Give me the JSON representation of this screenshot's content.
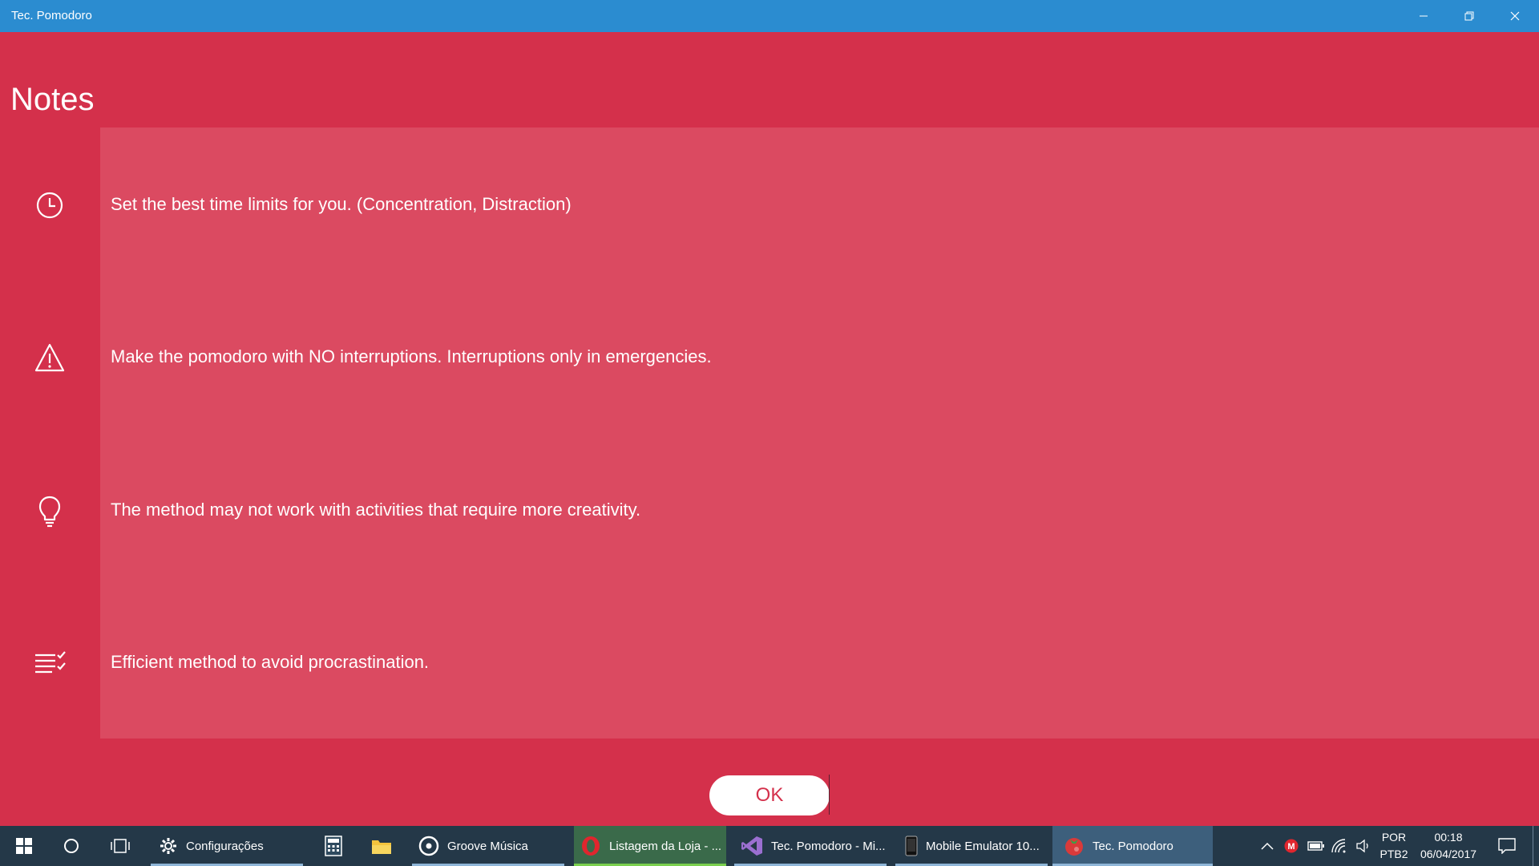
{
  "window": {
    "title": "Tec. Pomodoro",
    "controls": [
      "minimize-icon",
      "restore-icon",
      "close-icon"
    ]
  },
  "page": {
    "title": "Notes"
  },
  "notes": [
    {
      "icon": "clock-icon",
      "text": "Set the best time limits for you. (Concentration, Distraction)"
    },
    {
      "icon": "warning-icon",
      "text": "Make the pomodoro with NO interruptions. Interruptions only in emergencies."
    },
    {
      "icon": "lightbulb-icon",
      "text": "The method may not work with activities that require more creativity."
    },
    {
      "icon": "checklist-icon",
      "text": "Efficient method to avoid procrastination."
    }
  ],
  "ok_button": {
    "label": "OK"
  },
  "taskbar": {
    "items": [
      {
        "icon": "gear-icon",
        "label": "Configurações"
      },
      {
        "icon": "calculator-icon",
        "label": ""
      },
      {
        "icon": "file-explorer-icon",
        "label": ""
      },
      {
        "icon": "groove-music-icon",
        "label": "Groove Música"
      },
      {
        "icon": "opera-icon",
        "label": "Listagem da Loja - ..."
      },
      {
        "icon": "visual-studio-icon",
        "label": "Tec. Pomodoro - Mi..."
      },
      {
        "icon": "phone-icon",
        "label": "Mobile Emulator 10..."
      },
      {
        "icon": "tomato-icon",
        "label": "Tec. Pomodoro"
      }
    ],
    "language": {
      "line1": "POR",
      "line2": "PTB2"
    },
    "clock": {
      "time": "00:18",
      "date": "06/04/2017"
    }
  },
  "colors": {
    "title_bar": "#2b8cd0",
    "app_background": "#d4304b",
    "panel_background": "#db4a61",
    "taskbar": "#243848"
  }
}
